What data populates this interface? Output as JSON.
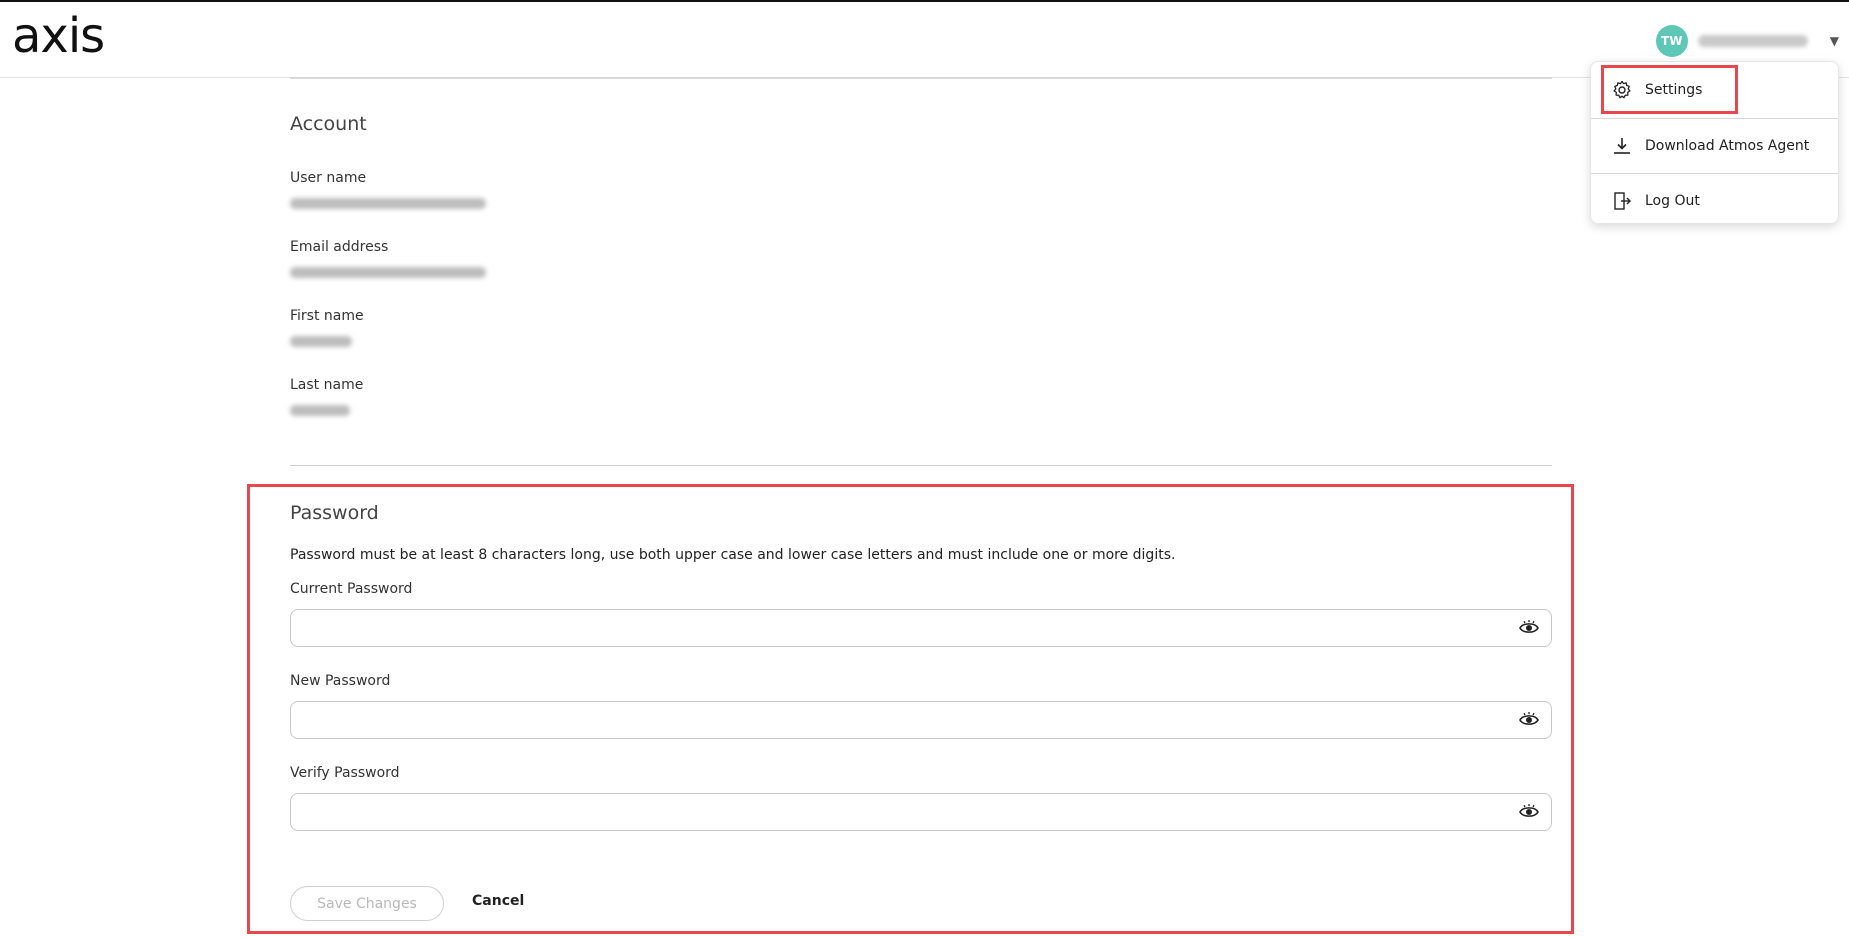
{
  "app": {
    "logo_text": "axis",
    "user_initials": "TW",
    "avatar_color": "#5ec7b8",
    "accent_highlight": "#e8474b"
  },
  "user_menu": {
    "items": [
      {
        "label": "Settings",
        "icon": "gear-icon"
      },
      {
        "label": "Download Atmos Agent",
        "icon": "download-icon"
      },
      {
        "label": "Log Out",
        "icon": "logout-icon"
      }
    ]
  },
  "account": {
    "title": "Account",
    "fields": [
      {
        "label": "User name"
      },
      {
        "label": "Email address"
      },
      {
        "label": "First name"
      },
      {
        "label": "Last name"
      }
    ]
  },
  "password": {
    "title": "Password",
    "hint": "Password must be at least 8 characters long, use both upper case and lower case letters and must include one or more digits.",
    "fields": [
      {
        "label": "Current Password",
        "value": ""
      },
      {
        "label": "New Password",
        "value": ""
      },
      {
        "label": "Verify Password",
        "value": ""
      }
    ],
    "save_label": "Save Changes",
    "cancel_label": "Cancel"
  }
}
